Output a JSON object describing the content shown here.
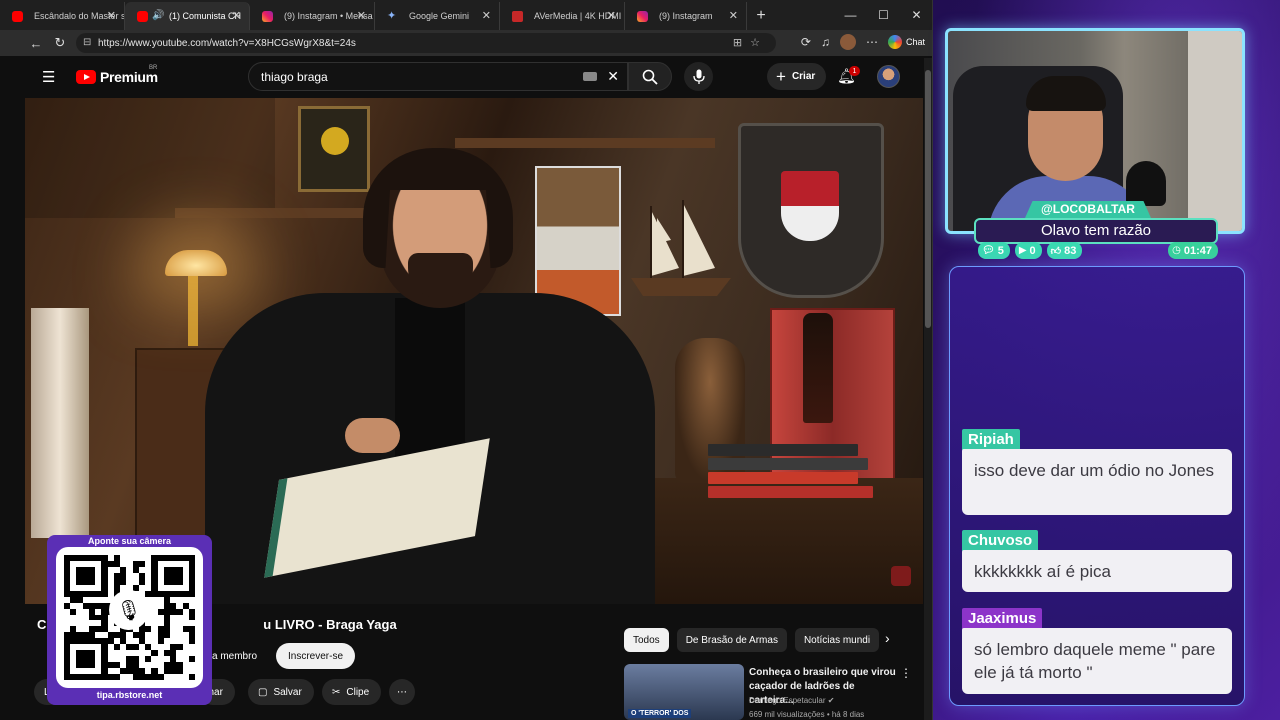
{
  "browser": {
    "tabs": [
      {
        "title": "Escândalo do Master s",
        "favicon": "youtube-icon",
        "active": false
      },
      {
        "title": "(1) Comunista CH",
        "favicon": "youtube-icon",
        "active": true,
        "audio": true
      },
      {
        "title": "(9) Instagram • Mensa",
        "favicon": "instagram-icon",
        "active": false
      },
      {
        "title": "Google Gemini",
        "favicon": "gemini-icon",
        "active": false
      },
      {
        "title": "AVerMedia | 4K HDMI",
        "favicon": "avermedia-icon",
        "active": false
      },
      {
        "title": "(9) Instagram",
        "favicon": "instagram-icon",
        "active": false
      }
    ],
    "url": "https://www.youtube.com/watch?v=X8HCGsWgrX8&t=24s",
    "chat_label": "Chat"
  },
  "youtube": {
    "logo": "Premium",
    "region": "BR",
    "search_query": "thiago braga",
    "create_label": "Criar",
    "notification_count": "1",
    "video": {
      "title_start": "C",
      "title_end": "u LIVRO - Braga Yaga"
    },
    "member_label": "a membro",
    "subscribe_label": "Inscrever-se",
    "actions": {
      "share_partial": "ilhar",
      "save": "Salvar",
      "clip": "Clipe",
      "left_partial": "L"
    },
    "chips": [
      "Todos",
      "De Brasão de Armas",
      "Notícias mundi"
    ],
    "recommendation": {
      "title": "Conheça o brasileiro que virou caçador de ladrões de carteira...",
      "channel": "Domingo Espetacular",
      "meta": "669 mil visualizações • há 8 dias",
      "thumb_tag": "O 'TERROR' DOS"
    }
  },
  "qr": {
    "top_text": "Aponte sua câmera",
    "bottom_text": "tipa.rbstore.net"
  },
  "stream": {
    "username": "@LOCOBALTAR",
    "caption": "Olavo tem razão",
    "stats": {
      "chat": "5",
      "video": "0",
      "likes": "83",
      "timer": "01:47"
    },
    "messages": [
      {
        "author": "Ripiah",
        "text": "isso deve dar um ódio no Jones",
        "color": "#36c6a3"
      },
      {
        "author": "Chuvoso",
        "text": "kkkkkkkk aí é pica",
        "color": "#36c6a3"
      },
      {
        "author": "Jaaximus",
        "text": "só lembro daquele meme \" pare ele já tá morto \"",
        "color": "#8c34c9"
      }
    ]
  }
}
